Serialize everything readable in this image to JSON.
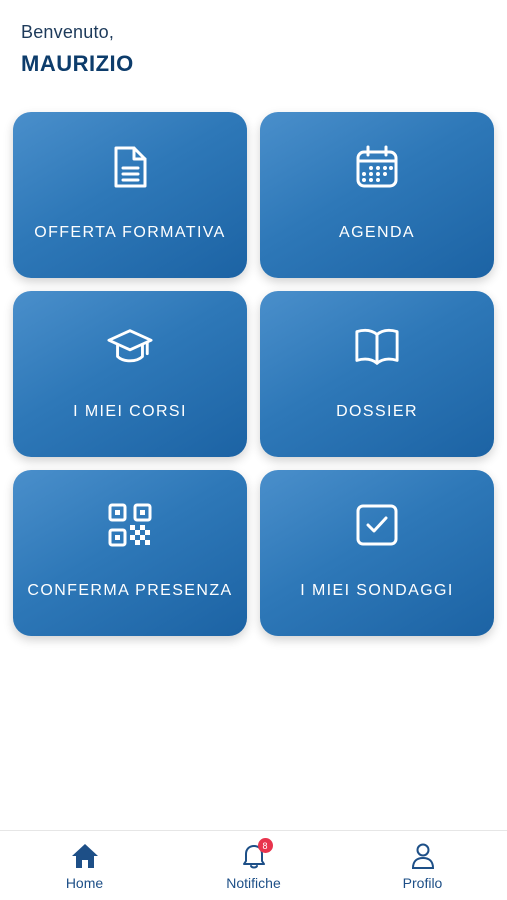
{
  "header": {
    "greeting": "Benvenuto,",
    "user_name": "MAURIZIO"
  },
  "tiles": [
    {
      "label": "OFFERTA FORMATIVA",
      "icon": "document-icon"
    },
    {
      "label": "AGENDA",
      "icon": "calendar-icon"
    },
    {
      "label": "I MIEI CORSI",
      "icon": "graduation-cap-icon"
    },
    {
      "label": "DOSSIER",
      "icon": "open-book-icon"
    },
    {
      "label": "CONFERMA PRESENZA",
      "icon": "qr-code-icon"
    },
    {
      "label": "I MIEI SONDAGGI",
      "icon": "checkbox-icon"
    }
  ],
  "tabbar": {
    "home": {
      "label": "Home",
      "icon": "home-icon"
    },
    "notifications": {
      "label": "Notifiche",
      "icon": "bell-icon",
      "badge": "8"
    },
    "profile": {
      "label": "Profilo",
      "icon": "user-icon"
    }
  },
  "colors": {
    "tile_gradient_start": "#4a8fcb",
    "tile_gradient_end": "#1c63a4",
    "accent": "#1d4f87",
    "badge": "#e8344d"
  }
}
